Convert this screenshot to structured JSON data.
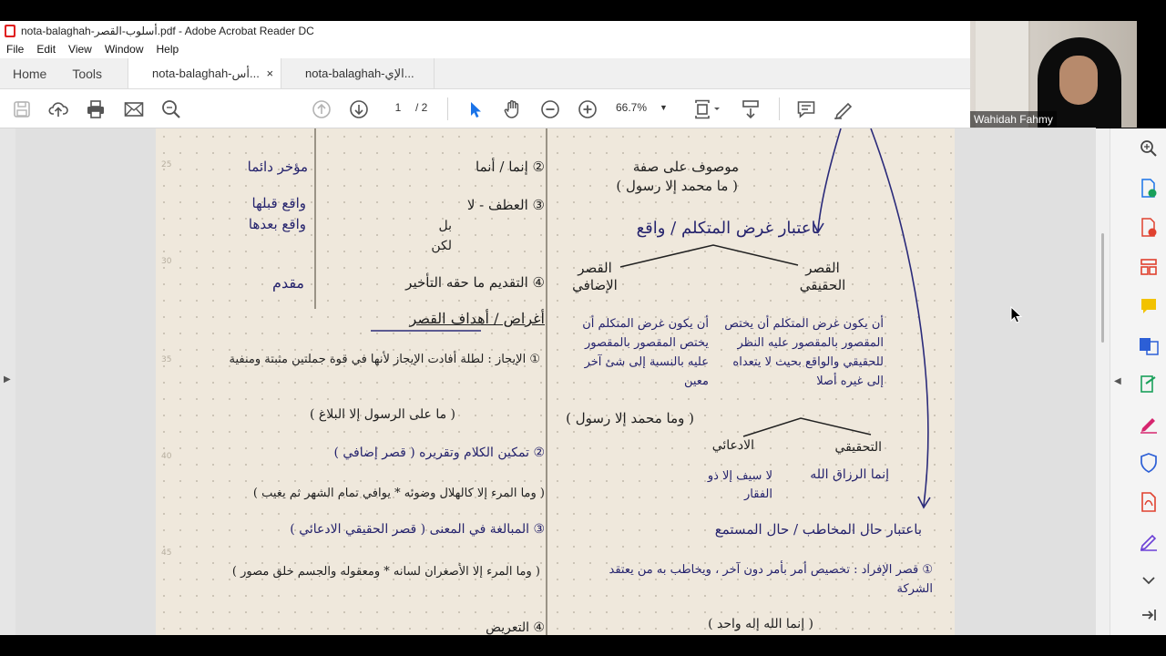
{
  "window": {
    "title": "nota-balaghah-أسلوب-القصر.pdf - Adobe Acrobat Reader DC"
  },
  "menu": [
    "File",
    "Edit",
    "View",
    "Window",
    "Help"
  ],
  "tabs": {
    "home": "Home",
    "tools": "Tools",
    "documents": [
      {
        "label": "nota-balaghah-أس...",
        "active": true,
        "close": "×"
      },
      {
        "label": "nota-balaghah-الإي...",
        "active": false
      }
    ]
  },
  "toolbar": {
    "page_current": "1",
    "page_total": "/ 2",
    "zoom": "66.7%",
    "icons": [
      "save-icon",
      "upload-icon",
      "print-icon",
      "email-icon",
      "search-icon",
      "prev-page-icon",
      "next-page-icon",
      "select-icon",
      "hand-icon",
      "zoom-out-icon",
      "zoom-in-icon",
      "fit-page-icon",
      "scroll-mode-icon",
      "comment-icon",
      "sign-icon"
    ]
  },
  "webcam": {
    "participant": "Wahidah Fahmy"
  },
  "document": {
    "right_column": [
      "موصوف على صفة",
      "( ما محمد إلا رسول )",
      "باعتبار غرض المتكلم / واقع",
      "القصر الحقيقي",
      "القصر الإضافي",
      "أن يكون غرض المتكلم أن يختص المقصور بالمقصور عليه النظر للحقيقي والواقع بحيث لا يتعداه إلى غيره أصلا",
      "أن يكون غرض المتكلم أن يختص المقصور بالمقصور عليه بالنسبة إلى شئ آخر معين",
      "( وما محمد إلا رسول )",
      "التحقيقي",
      "الادعائي",
      "إنما الرزاق الله",
      "لا سيف إلا ذو الفقار",
      "باعتبار حال المخاطب / حال المستمع",
      "① قصر الإفراد : تخصيص أمر بأمر دون آخر ، ويخاطب به من يعتقد الشركة",
      "( إنما الله إله واحد )"
    ],
    "left_column": [
      "مؤخر دائما",
      "② إنما / أنما",
      "واقع قبلها",
      "واقع بعدها",
      "③ العطف - لا",
      "بل",
      "لكن",
      "④ التقديم ما حقه التأخير",
      "مقدم",
      "أغراض / أهداف القصر",
      "① الإيجاز : لطلة أفادت الإيجاز لأنها في قوة جملتين مثبتة ومنفية",
      "( ما على الرسول إلا البلاغ )",
      "② تمكين الكلام وتقريره ( قصر إضافي )",
      "( وما المرء إلا كالهلال وضوئه * يوافي تمام الشهر ثم يغيب )",
      "③ المبالغة في المعنى ( قصر الحقيقي الادعائي )",
      "( وما المرء إلا الأصغران لسانه * ومعقوله والجسم خلق مصور )",
      "④ التعريض"
    ],
    "line_numbers": [
      "25",
      "30",
      "35",
      "40",
      "45"
    ]
  }
}
